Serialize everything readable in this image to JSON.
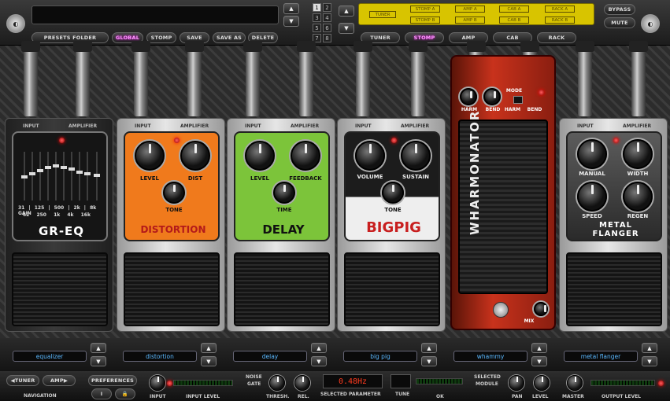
{
  "top": {
    "presets_folder": "PRESETS FOLDER",
    "global": "GLOBAL",
    "stomp": "STOMP",
    "save": "SAVE",
    "save_as": "SAVE AS",
    "delete": "DELETE",
    "slots": [
      "1",
      "2",
      "3",
      "4",
      "5",
      "6",
      "7",
      "8"
    ],
    "active_slot": "1",
    "bypass": "BYPASS",
    "mute": "MUTE"
  },
  "chain": {
    "tuner": "TUNER",
    "stomp_a": "STOMP A",
    "stomp_b": "STOMP B",
    "amp_a": "AMP A",
    "amp_b": "AMP B",
    "cab_a": "CAB A",
    "cab_b": "CAB B",
    "rack_a": "RACK A",
    "rack_b": "RACK B"
  },
  "tabs": [
    "TUNER",
    "STOMP",
    "AMP",
    "CAB",
    "RACK"
  ],
  "active_tab": "STOMP",
  "pedal_io": {
    "input": "INPUT",
    "amplifier": "AMPLIFIER"
  },
  "pedals": {
    "eq": {
      "title": "GR-EQ",
      "bands": [
        "31",
        "125",
        "500",
        "2k",
        "8k"
      ],
      "bands2": [
        "62",
        "250",
        "1k",
        "4k",
        "16k"
      ],
      "gain": "GAIN"
    },
    "distortion": {
      "title": "DISTORTION",
      "level": "LEVEL",
      "dist": "DIST",
      "tone": "TONE"
    },
    "delay": {
      "title": "DELAY",
      "level": "LEVEL",
      "feedback": "FEEDBACK",
      "time": "TIME"
    },
    "bigpig": {
      "title": "BIGPIG",
      "volume": "VOLUME",
      "sustain": "SUSTAIN",
      "tone": "TONE"
    },
    "whammy": {
      "title": "WHARMONATOR",
      "harm": "HARM",
      "bend": "BEND",
      "mode": "MODE",
      "mode_harm": "HARM",
      "mode_bend": "BEND",
      "mix": "MIX"
    },
    "flanger": {
      "title_1": "METAL",
      "title_2": "FLANGER",
      "manual": "MANUAL",
      "width": "WIDTH",
      "speed": "SPEED",
      "regen": "REGEN"
    }
  },
  "selectors": [
    "equalizer",
    "distortion",
    "delay",
    "big pig",
    "whammy",
    "metal flanger"
  ],
  "bottom": {
    "tuner": "TUNER",
    "amp": "AMP",
    "navigation": "NAVIGATION",
    "preferences": "PREFERENCES",
    "pref_i": "I",
    "input": "INPUT",
    "input_level": "INPUT LEVEL",
    "noise_gate_1": "NOISE",
    "noise_gate_2": "GATE",
    "thresh": "THRESH.",
    "rel": "REL.",
    "param_value": "0.48Hz",
    "selected_parameter": "SELECTED PARAMETER",
    "tune": "TUNE",
    "ok": "OK",
    "selected_module_1": "SELECTED",
    "selected_module_2": "MODULE",
    "pan": "PAN",
    "level": "LEVEL",
    "master": "MASTER",
    "output_level": "OUTPUT LEVEL"
  },
  "colors": {
    "distortion": "#f07a1c",
    "delay": "#7cc43a",
    "whammy": "#c8321c",
    "selector_text": "#5ab8ff",
    "chain": "#d8c400",
    "param": "#ff3b1f"
  }
}
